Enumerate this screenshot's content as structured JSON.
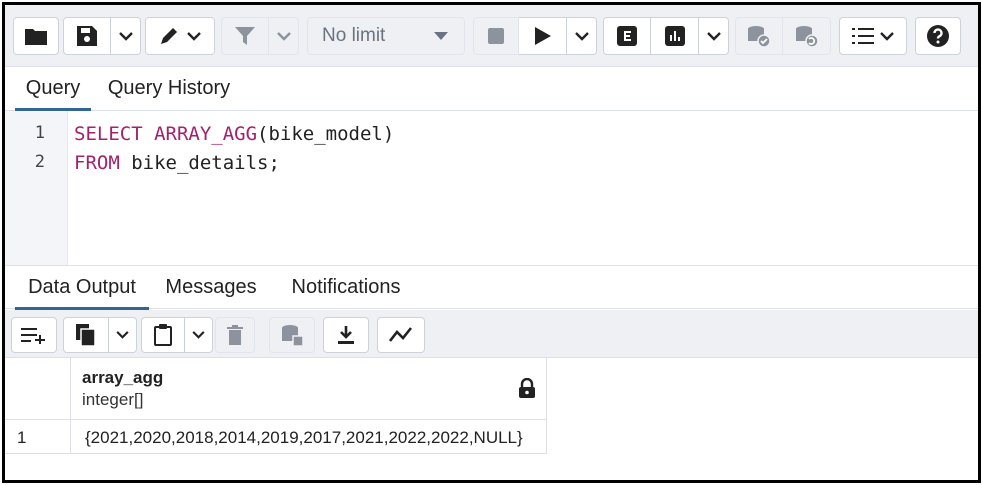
{
  "toolbar": {
    "limit_label": "No limit",
    "icons": [
      "open-file-icon",
      "save-icon",
      "chevron-down-icon",
      "edit-pencil-icon",
      "filter-icon",
      "stop-icon",
      "play-icon",
      "explain-icon",
      "explain-analyze-icon",
      "commit-icon",
      "rollback-icon",
      "macros-icon",
      "help-icon"
    ]
  },
  "query_tabs": [
    {
      "label": "Query",
      "active": true
    },
    {
      "label": "Query History",
      "active": false
    }
  ],
  "editor": {
    "lines": [
      {
        "num": "1",
        "kw": "SELECT ARRAY_AGG",
        "rest": "(bike_model)"
      },
      {
        "num": "2",
        "kw": "FROM",
        "rest": " bike_details;"
      }
    ]
  },
  "output_tabs": [
    {
      "label": "Data Output",
      "active": true
    },
    {
      "label": "Messages",
      "active": false
    },
    {
      "label": "Notifications",
      "active": false
    }
  ],
  "grid": {
    "column": {
      "name": "array_agg",
      "type": "integer[]"
    },
    "rows": [
      {
        "num": "1",
        "value": "{2021,2020,2018,2014,2019,2017,2021,2022,2022,NULL}"
      }
    ]
  },
  "colors": {
    "keyword": "#a3226b",
    "active_tab": "#326690",
    "toolbar_bg": "#eef0f4"
  }
}
